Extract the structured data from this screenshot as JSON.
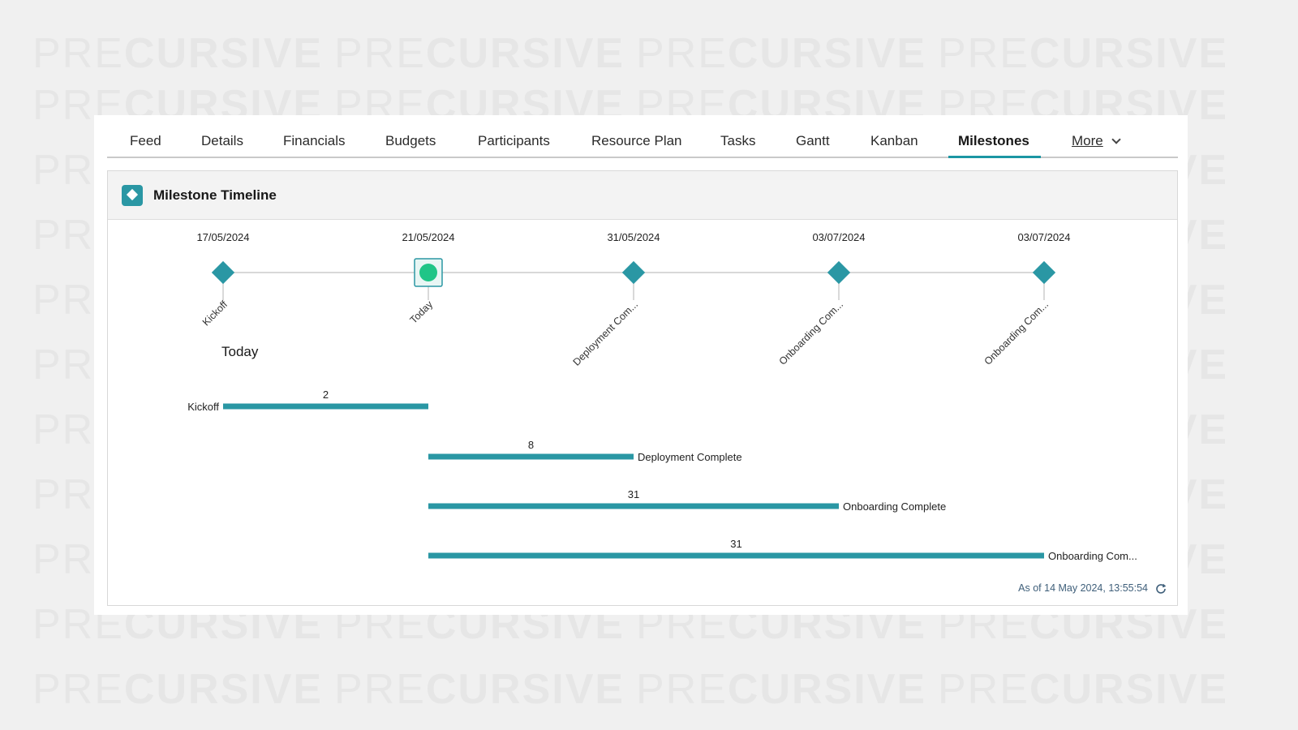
{
  "watermark": {
    "prefix": "PRE",
    "suffix": "CURSIVE"
  },
  "tabs": [
    {
      "label": "Feed"
    },
    {
      "label": "Details"
    },
    {
      "label": "Financials"
    },
    {
      "label": "Budgets"
    },
    {
      "label": "Participants"
    },
    {
      "label": "Resource Plan"
    },
    {
      "label": "Tasks"
    },
    {
      "label": "Gantt"
    },
    {
      "label": "Kanban"
    },
    {
      "label": "Milestones",
      "active": true
    },
    {
      "label": "More"
    }
  ],
  "panel": {
    "title": "Milestone Timeline",
    "icon": "milestone-diamond-icon",
    "today_label": "Today",
    "as_of": "As of 14 May 2024, 13:55:54"
  },
  "colors": {
    "accent": "#2a97a4",
    "today_marker": "#1fc587",
    "bar": "#2a97a4"
  },
  "chart_data": {
    "type": "timeline",
    "milestones": [
      {
        "date": "17/05/2024",
        "label": "Kickoff",
        "kind": "milestone"
      },
      {
        "date": "21/05/2024",
        "label": "Today",
        "kind": "today"
      },
      {
        "date": "31/05/2024",
        "label": "Deployment Com...",
        "kind": "milestone"
      },
      {
        "date": "03/07/2024",
        "label": "Onboarding Com...",
        "kind": "milestone"
      },
      {
        "date": "03/07/2024",
        "label": "Onboarding Com...",
        "kind": "milestone"
      }
    ],
    "bars": [
      {
        "name": "Kickoff",
        "value": 2,
        "from": 0,
        "to": 1,
        "label_side": "left"
      },
      {
        "name": "Deployment Complete",
        "value": 8,
        "from": 1,
        "to": 2,
        "label_side": "right"
      },
      {
        "name": "Onboarding Complete",
        "value": 31,
        "from": 1,
        "to": 3,
        "label_side": "right"
      },
      {
        "name": "Onboarding Com...",
        "value": 31,
        "from": 1,
        "to": 4,
        "label_side": "right"
      }
    ]
  }
}
